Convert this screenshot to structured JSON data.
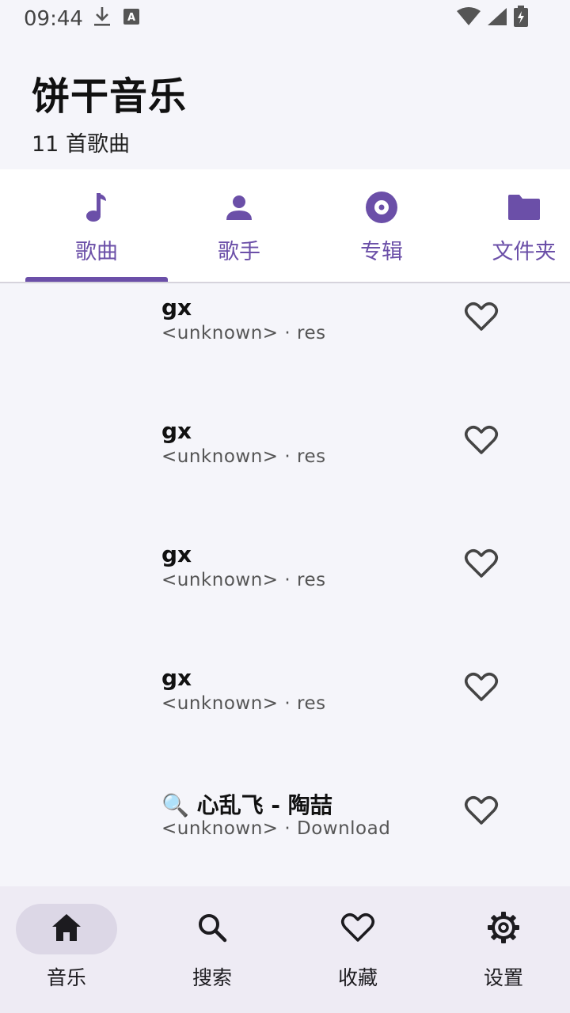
{
  "status": {
    "time": "09:44",
    "icons": [
      "download-icon",
      "font-a-icon",
      "wifi-icon",
      "signal-icon",
      "battery-charging-icon"
    ]
  },
  "header": {
    "title": "饼干音乐",
    "subtitle": "11 首歌曲"
  },
  "colors": {
    "accent": "#6b4fa8",
    "background": "#f5f5fa",
    "nav_background": "#eeebf4",
    "nav_active_pill": "#dcd7e6"
  },
  "tabs": [
    {
      "label": "歌曲",
      "icon": "music-note-icon",
      "selected": true
    },
    {
      "label": "歌手",
      "icon": "person-icon",
      "selected": false
    },
    {
      "label": "专辑",
      "icon": "album-disc-icon",
      "selected": false
    },
    {
      "label": "文件夹",
      "icon": "folder-icon",
      "selected": false
    }
  ],
  "songs": [
    {
      "title": "gx",
      "subtitle": "<unknown> · res",
      "icon": "heart-outline-icon"
    },
    {
      "title": "gx",
      "subtitle": "<unknown> · res",
      "icon": "heart-outline-icon"
    },
    {
      "title": "gx",
      "subtitle": "<unknown> · res",
      "icon": "heart-outline-icon"
    },
    {
      "title": "gx",
      "subtitle": "<unknown> · res",
      "icon": "heart-outline-icon"
    },
    {
      "title": "🔍 心乱飞 - 陶喆",
      "subtitle": "<unknown> · Download",
      "icon": "heart-outline-icon"
    }
  ],
  "bottom_nav": [
    {
      "label": "音乐",
      "icon": "home-icon",
      "selected": true
    },
    {
      "label": "搜索",
      "icon": "search-icon",
      "selected": false
    },
    {
      "label": "收藏",
      "icon": "heart-outline-icon",
      "selected": false
    },
    {
      "label": "设置",
      "icon": "gear-icon",
      "selected": false
    }
  ]
}
